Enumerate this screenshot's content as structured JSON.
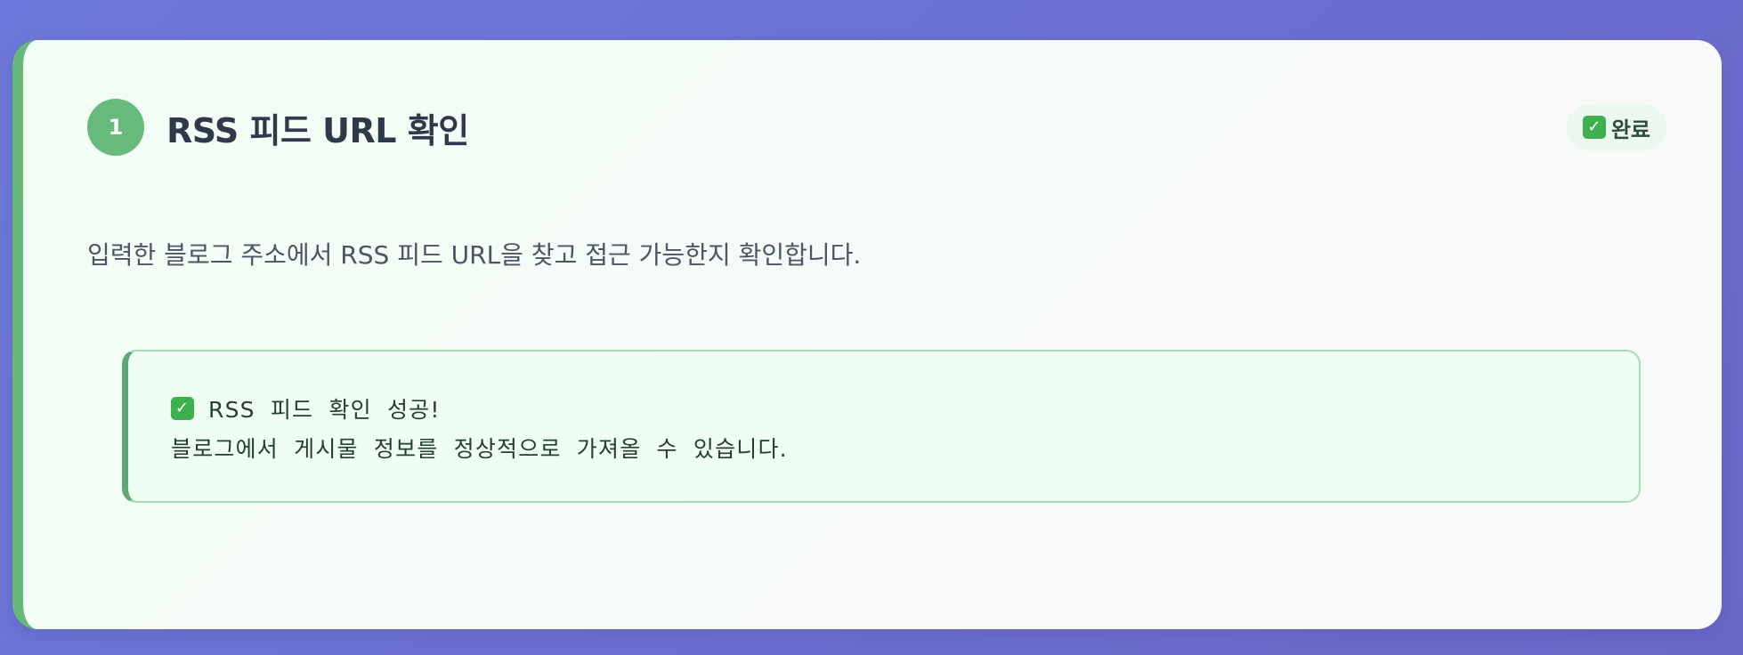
{
  "step": {
    "number": "1",
    "title": "RSS 피드 URL 확인",
    "status_label": "완료",
    "description": "입력한 블로그 주소에서 RSS 피드 URL을 찾고 접근 가능한지 확인합니다."
  },
  "result": {
    "title": "RSS 피드 확인 성공!",
    "message": "블로그에서 게시물 정보를 정상적으로 가져올 수 있습니다."
  },
  "icons": {
    "status_icon": "check-box-icon",
    "result_icon": "check-box-icon"
  },
  "colors": {
    "accent_green": "#67ba7c",
    "background": "#6c78d9"
  }
}
